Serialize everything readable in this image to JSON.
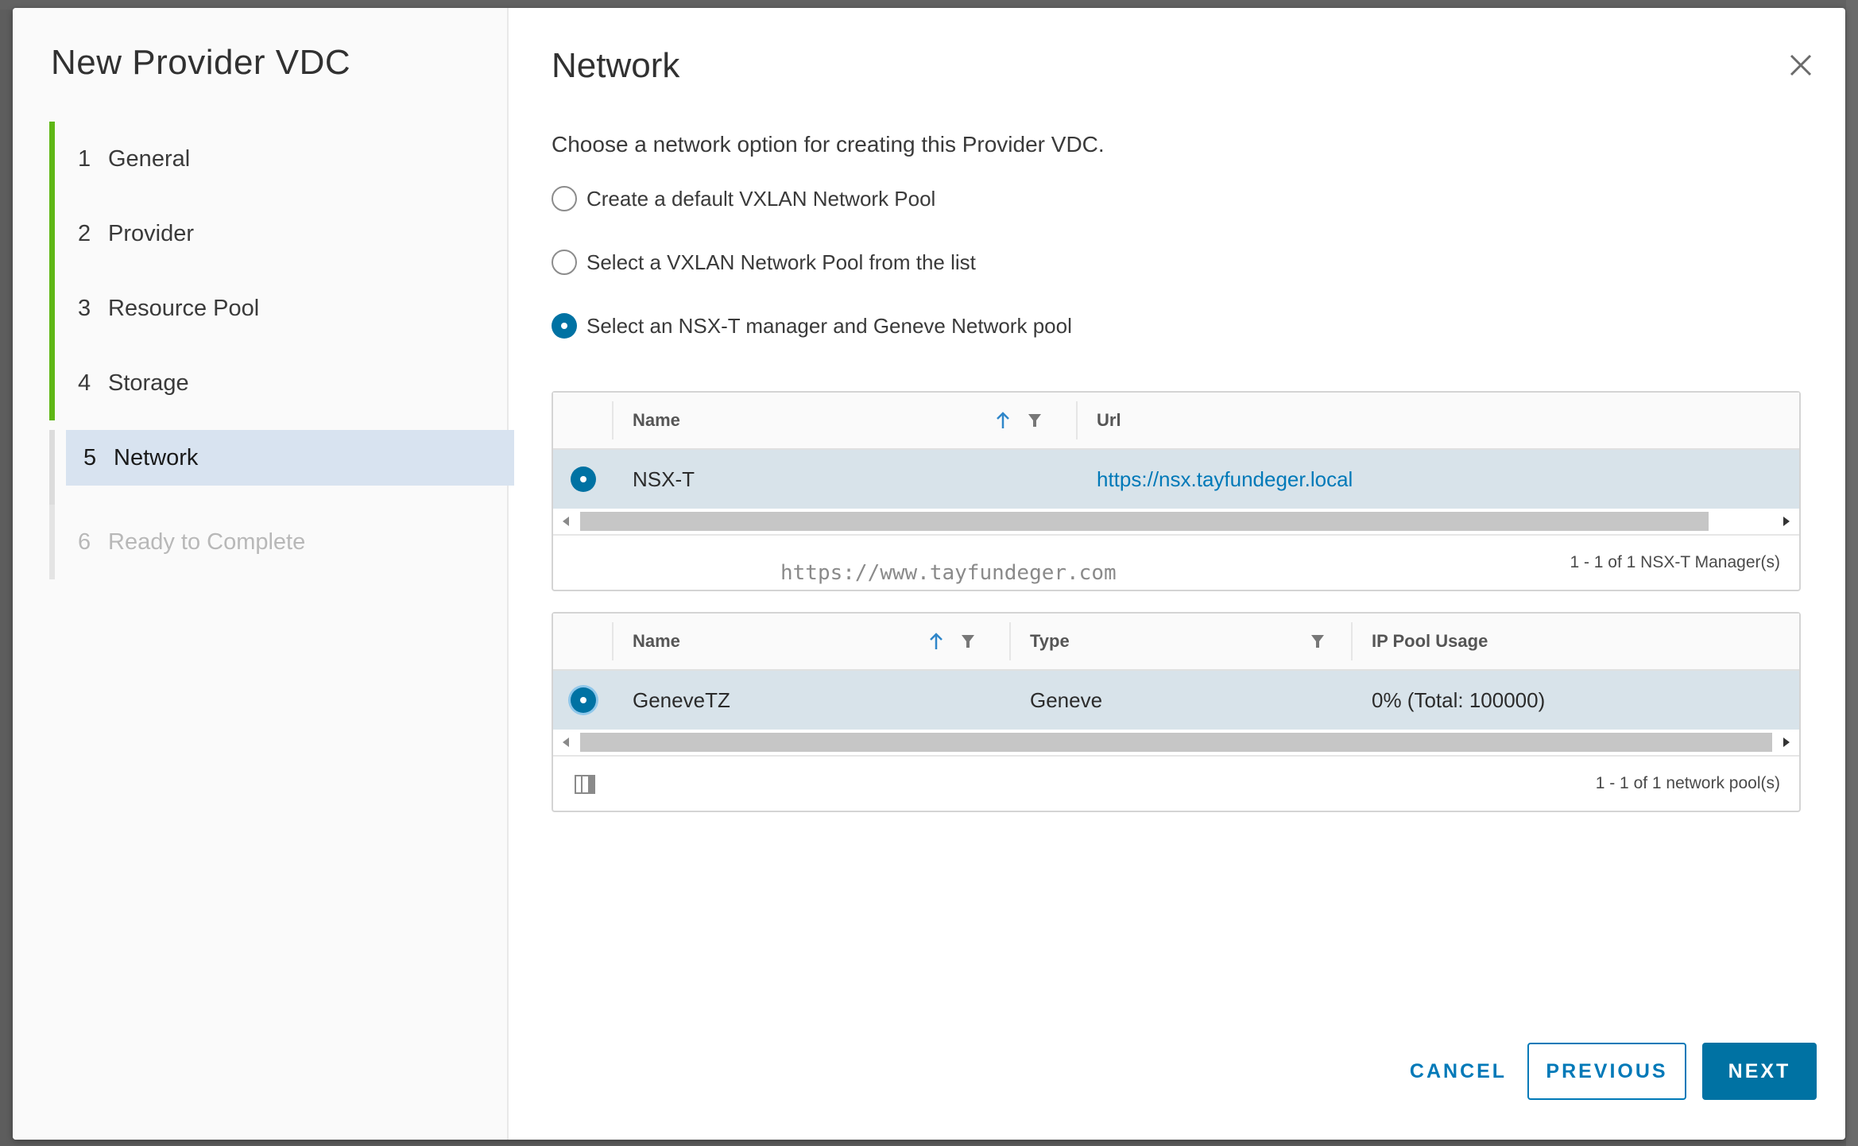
{
  "wizard": {
    "title": "New Provider VDC",
    "steps": [
      {
        "num": "1",
        "label": "General",
        "state": "done"
      },
      {
        "num": "2",
        "label": "Provider",
        "state": "done"
      },
      {
        "num": "3",
        "label": "Resource Pool",
        "state": "done"
      },
      {
        "num": "4",
        "label": "Storage",
        "state": "done"
      },
      {
        "num": "5",
        "label": "Network",
        "state": "active"
      },
      {
        "num": "6",
        "label": "Ready to Complete",
        "state": "disabled"
      }
    ]
  },
  "page": {
    "title": "Network",
    "intro": "Choose a network option for creating this Provider VDC.",
    "options": [
      {
        "label": "Create a default VXLAN Network Pool",
        "selected": false
      },
      {
        "label": "Select a VXLAN Network Pool from the list",
        "selected": false
      },
      {
        "label": "Select an NSX-T manager and Geneve Network pool",
        "selected": true
      }
    ]
  },
  "managers_grid": {
    "columns": [
      "Name",
      "Url"
    ],
    "rows": [
      {
        "name": "NSX-T",
        "url": "https://nsx.tayfundeger.local",
        "selected": true
      }
    ],
    "footer": "1 - 1 of 1 NSX-T Manager(s)"
  },
  "pools_grid": {
    "columns": [
      "Name",
      "Type",
      "IP Pool Usage"
    ],
    "rows": [
      {
        "name": "GeneveTZ",
        "type": "Geneve",
        "usage": "0% (Total: 100000)",
        "selected": true
      }
    ],
    "footer": "1 - 1 of 1 network pool(s)"
  },
  "watermark": "https://www.tayfundeger.com",
  "buttons": {
    "cancel": "CANCEL",
    "previous": "PREVIOUS",
    "next": "NEXT"
  },
  "colors": {
    "accent": "#0072a3",
    "link": "#0079b8",
    "done_bar": "#5eb715",
    "selected_row": "#d8e3ea"
  }
}
